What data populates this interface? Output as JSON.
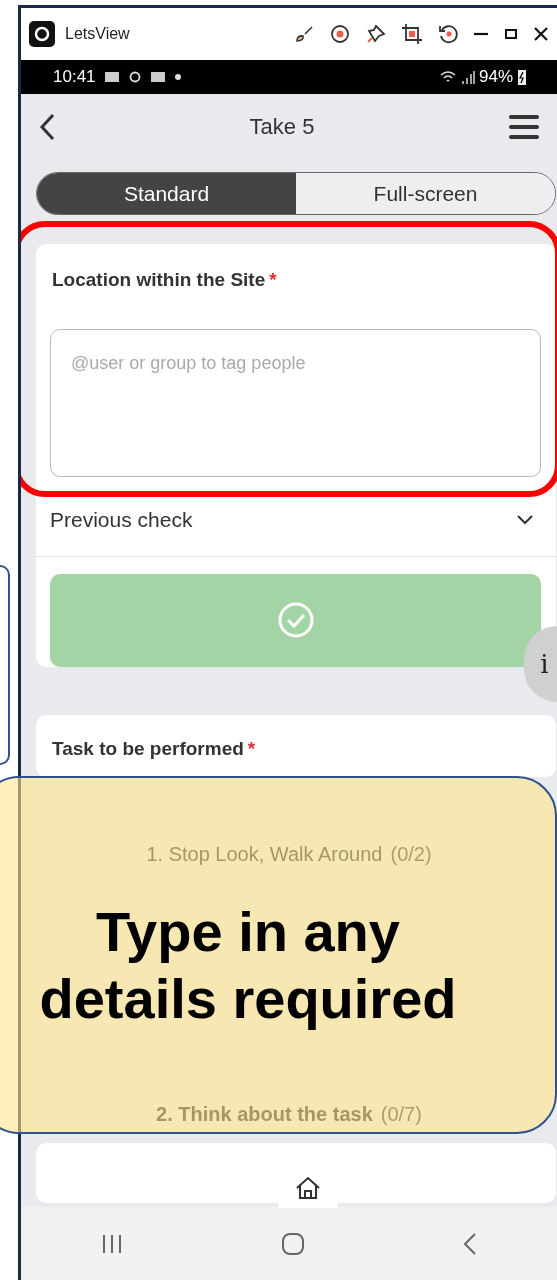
{
  "window": {
    "title": "LetsView"
  },
  "status_bar": {
    "time": "10:41",
    "battery": "94%"
  },
  "header": {
    "title": "Take 5"
  },
  "view_modes": [
    {
      "label": "Standard",
      "selected": true
    },
    {
      "label": "Full-screen",
      "selected": false
    }
  ],
  "location_field": {
    "label": "Location within the Site",
    "required_mark": "*",
    "placeholder": "@user or group to tag people"
  },
  "previous_check": {
    "label": "Previous check",
    "expanded": false
  },
  "task": {
    "label": "Task to be performed",
    "required_mark": "*",
    "sections": [
      {
        "title": "1. Stop Look, Walk Around",
        "count": "(0/2)"
      },
      {
        "title": "2. Think about the task",
        "count": "(0/7)"
      }
    ]
  },
  "info_button": {
    "label": "i"
  },
  "callout": {
    "text": "Type in any details required"
  }
}
